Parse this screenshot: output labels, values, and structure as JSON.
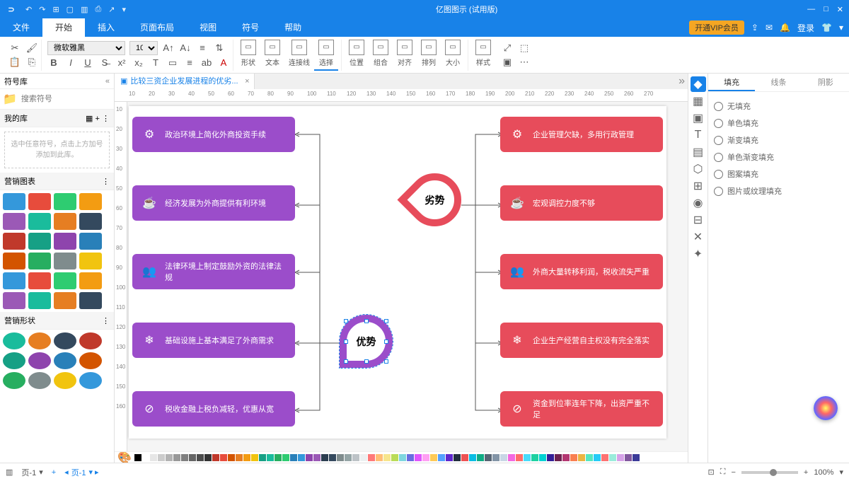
{
  "app": {
    "title": "亿图图示 (试用版)"
  },
  "menu": {
    "tabs": [
      "文件",
      "开始",
      "插入",
      "页面布局",
      "视图",
      "符号",
      "帮助"
    ],
    "activeIndex": 1,
    "vip": "开通VIP会员",
    "login": "登录"
  },
  "ribbon": {
    "font": "微软雅黑",
    "size": "10",
    "groups": [
      {
        "name": "形状"
      },
      {
        "name": "文本"
      },
      {
        "name": "连接线"
      },
      {
        "name": "选择"
      },
      {
        "name": "位置"
      },
      {
        "name": "组合"
      },
      {
        "name": "对齐"
      },
      {
        "name": "排列"
      },
      {
        "name": "大小"
      },
      {
        "name": "样式"
      }
    ]
  },
  "leftpanel": {
    "title": "符号库",
    "search_ph": "搜索符号",
    "mylib": "我的库",
    "mylib_empty": "选中任意符号，点击上方加号添加到此库。",
    "sect1": "营销图表",
    "sect2": "营销形状"
  },
  "doc": {
    "tab": "比较三资企业发展进程的优劣..."
  },
  "hubs": {
    "weak": "劣势",
    "strong": "优势"
  },
  "nodes": {
    "left": [
      "政治环境上简化外商投资手续",
      "经济发展为外商提供有利环境",
      "法律环境上制定鼓励外资的法律法规",
      "基础设施上基本满足了外商需求",
      "税收金融上税负减轻，优惠从宽"
    ],
    "right": [
      "企业管理欠缺，多用行政管理",
      "宏观调控力度不够",
      "外商大量转移利润，税收流失严重",
      "企业生产经营自主权没有完全落实",
      "资金到位率连年下降，出资严重不足"
    ]
  },
  "rpanel": {
    "tabs": [
      "填充",
      "线条",
      "阴影"
    ],
    "activeIndex": 0,
    "opts": [
      "无填充",
      "单色填充",
      "渐变填充",
      "单色渐变填充",
      "图案填充",
      "图片或纹理填充"
    ]
  },
  "status": {
    "page": "页-1",
    "zoom": "100%"
  },
  "rulerH": [
    10,
    20,
    30,
    40,
    50,
    60,
    70,
    80,
    90,
    100,
    110,
    120,
    130,
    140,
    150,
    160,
    170,
    180,
    190,
    200,
    210,
    220,
    230,
    240,
    250,
    260,
    270
  ],
  "rulerV": [
    10,
    20,
    30,
    40,
    50,
    60,
    70,
    80,
    90,
    100,
    110,
    120,
    130,
    140,
    150,
    160
  ],
  "colors": [
    "#000",
    "#fff",
    "#e6e6e6",
    "#ccc",
    "#b3b3b3",
    "#999",
    "#808080",
    "#666",
    "#4d4d4d",
    "#333",
    "#c0392b",
    "#e74c3c",
    "#d35400",
    "#e67e22",
    "#f39c12",
    "#f1c40f",
    "#16a085",
    "#1abc9c",
    "#27ae60",
    "#2ecc71",
    "#2980b9",
    "#3498db",
    "#8e44ad",
    "#9b59b6",
    "#2c3e50",
    "#34495e",
    "#7f8c8d",
    "#95a5a6",
    "#bdc3c7",
    "#ecf0f1",
    "#ff7979",
    "#ffbe76",
    "#f6e58d",
    "#badc58",
    "#7ed6df",
    "#686de0",
    "#e056fd",
    "#ff9ff3",
    "#feca57",
    "#54a0ff",
    "#5f27cd",
    "#222f3e",
    "#ee5253",
    "#0abde3",
    "#10ac84",
    "#576574",
    "#8395a7",
    "#c8d6e5",
    "#f368e0",
    "#ff6b6b",
    "#48dbfb",
    "#1dd1a1",
    "#00d2d3",
    "#341f97",
    "#6D214F",
    "#B33771",
    "#F97F51",
    "#EAB543",
    "#55E6C1",
    "#25CCF7",
    "#FD7272",
    "#9AECDB",
    "#D6A2E8",
    "#82589F",
    "#3B3B98"
  ]
}
